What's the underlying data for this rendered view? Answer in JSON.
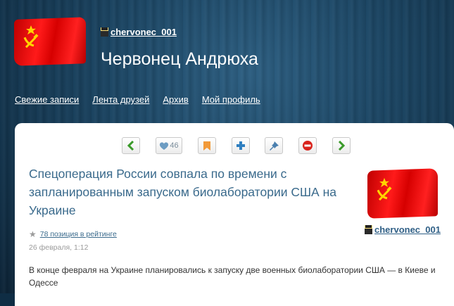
{
  "header": {
    "username": "chervonec_001",
    "blog_title": "Червонец Андрюха"
  },
  "nav": {
    "items": [
      "Свежие записи",
      "Лента друзей",
      "Архив",
      "Мой профиль"
    ]
  },
  "toolbar": {
    "like_count": "46",
    "icons": [
      "chevron-left-icon",
      "heart-icon",
      "bookmark-icon",
      "plus-icon",
      "pin-icon",
      "block-icon",
      "chevron-right-icon"
    ]
  },
  "post": {
    "title": "Спецоперация России совпала по времени с запланированным запуском биолаборатории США на Украине",
    "rating_text": "78 позиция в рейтинге",
    "date": "26 февраля, 1:12",
    "author": "chervonec_001",
    "excerpt": "В конце февраля на Украине планировались к запуску две военных биолаборатории США — в Киеве и Одессе"
  },
  "colors": {
    "accent": "#3a6a8c",
    "flag_red": "#e00000",
    "green_arrow": "#3a9a2a",
    "orange_bookmark": "#f29a38",
    "red_block": "#d9231c"
  }
}
